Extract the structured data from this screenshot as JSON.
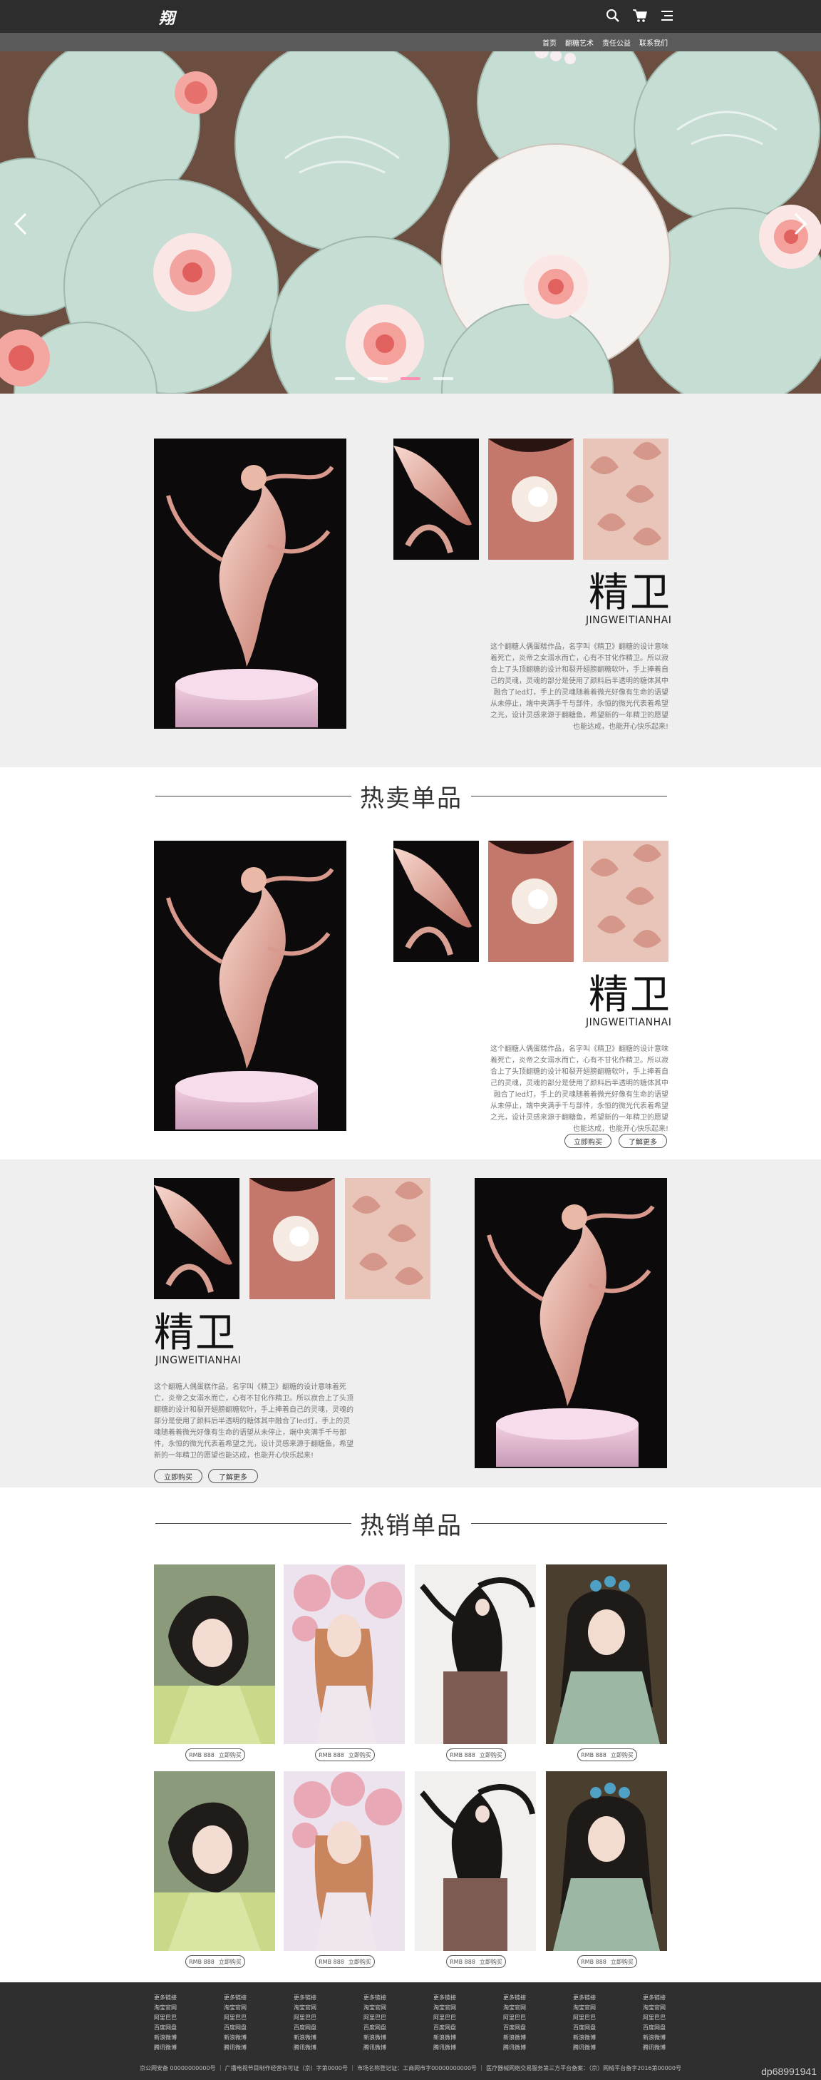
{
  "header": {
    "logo": "翔",
    "nav": [
      "首页",
      "翻糖艺术",
      "责任公益",
      "联系我们"
    ]
  },
  "hero": {
    "slide_count": 4,
    "active_slide": 3
  },
  "feature1": {
    "title_cn": "精卫",
    "title_en": "JINGWEITIANHAI",
    "desc": "这个翻糖人偶蛋糕作品，名字叫《精卫》翻糖的设计意味着死亡，炎帝之女溺水而亡，心有不甘化作精卫。所以寂合上了头顶翻糖的设计和裂开翅膀翻糖软叶，手上捧着自己的灵魂，灵魂的部分是使用了颜料后半透明的糖体其中融合了led灯，手上的灵魂随着着微光好像有生命的语望从未停止，端中夹满手千与部件，永恒的微光代表着希望之光，设计灵感来源于翻糖鱼，希望新的一年精卫的愿望也能达成，也能开心快乐起来!"
  },
  "hot_single": {
    "heading": "热卖单品",
    "title_cn": "精卫",
    "title_en": "JINGWEITIANHAI",
    "desc": "这个翻糖人偶蛋糕作品，名字叫《精卫》翻糖的设计意味着死亡，炎帝之女溺水而亡，心有不甘化作精卫。所以寂合上了头顶翻糖的设计和裂开翅膀翻糖软叶，手上捧着自己的灵魂，灵魂的部分是使用了颜料后半透明的糖体其中融合了led灯，手上的灵魂随着着微光好像有生命的语望从未停止，端中夹满手千与部件，永恒的微光代表着希望之光，设计灵感来源于翻糖鱼，希望新的一年精卫的愿望也能达成，也能开心快乐起来!",
    "buy_label": "立即购买",
    "more_label": "了解更多"
  },
  "feature3": {
    "title_cn": "精卫",
    "title_en": "JINGWEITIANHAI",
    "desc": "这个翻糖人偶蛋糕作品，名字叫《精卫》翻糖的设计意味着死亡，炎帝之女溺水而亡，心有不甘化作精卫。所以寂合上了头顶翻糖的设计和裂开翅膀翻糖软叶，手上捧着自己的灵魂，灵魂的部分是使用了颜料后半透明的糖体其中融合了led灯，手上的灵魂随着着微光好像有生命的语望从未停止，端中夹满手千与部件，永恒的微光代表着希望之光，设计灵感来源于翻糖鱼，希望新的一年精卫的愿望也能达成，也能开心快乐起来!",
    "buy_label": "立即购买",
    "more_label": "了解更多"
  },
  "hot_sale": {
    "heading": "热销单品",
    "price_label": "RMB 888",
    "buy_label": "立即购买"
  },
  "footer": {
    "columns": [
      [
        "更多链接",
        "淘宝官网",
        "阿里巴巴",
        "百度网盘",
        "新浪微博",
        "腾讯微博"
      ],
      [
        "更多链接",
        "淘宝官网",
        "阿里巴巴",
        "百度网盘",
        "新浪微博",
        "腾讯微博"
      ],
      [
        "更多链接",
        "淘宝官网",
        "阿里巴巴",
        "百度网盘",
        "新浪微博",
        "腾讯微博"
      ],
      [
        "更多链接",
        "淘宝官网",
        "阿里巴巴",
        "百度网盘",
        "新浪微博",
        "腾讯微博"
      ],
      [
        "更多链接",
        "淘宝官网",
        "阿里巴巴",
        "百度网盘",
        "新浪微博",
        "腾讯微博"
      ],
      [
        "更多链接",
        "淘宝官网",
        "阿里巴巴",
        "百度网盘",
        "新浪微博",
        "腾讯微博"
      ],
      [
        "更多链接",
        "淘宝官网",
        "阿里巴巴",
        "百度网盘",
        "新浪微博",
        "腾讯微博"
      ],
      [
        "更多链接",
        "淘宝官网",
        "阿里巴巴",
        "百度网盘",
        "新浪微博",
        "腾讯微博"
      ]
    ],
    "copyright": "京公网安备 00000000000号 ｜ 广播电视节目制作经营许可证（京）字第0000号 ｜ 市场名称登记证：工商网市字00000000000号 ｜ 医疗器械网络交易服务第三方平台备案：（京）网械平台备字2016第00000号",
    "watermark": "dp68991941"
  },
  "colors": {
    "header_bg": "#2d2d2d",
    "nav_bg": "#5a5a5a",
    "section_grey": "#efefef",
    "footer_bg": "#2f2f2f",
    "dot_active": "#ff8fb0"
  }
}
